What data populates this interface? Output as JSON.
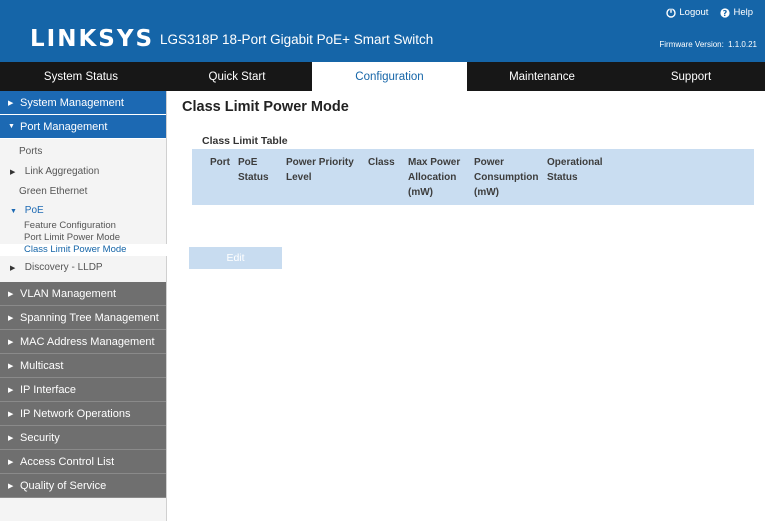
{
  "header": {
    "logo": "LINKSYS",
    "product": "LGS318P 18-Port Gigabit PoE+ Smart Switch",
    "logout": "Logout",
    "help": "Help",
    "firmware_label": "Firmware Version:",
    "firmware_version": "1.1.0.21"
  },
  "nav": {
    "tabs": [
      {
        "label": "System Status"
      },
      {
        "label": "Quick Start"
      },
      {
        "label": "Configuration",
        "active": true
      },
      {
        "label": "Maintenance"
      },
      {
        "label": "Support"
      }
    ]
  },
  "sidebar": {
    "system_management": "System Management",
    "port_management": "Port Management",
    "port_items": {
      "ports": "Ports",
      "link_aggregation": "Link Aggregation",
      "green_ethernet": "Green Ethernet",
      "poe": "PoE",
      "poe_items": [
        "Feature Configuration",
        "Port Limit Power Mode",
        "Class Limit Power Mode"
      ],
      "discovery": "Discovery - LLDP"
    },
    "groups": [
      "VLAN Management",
      "Spanning Tree Management",
      "MAC Address Management",
      "Multicast",
      "IP Interface",
      "IP Network Operations",
      "Security",
      "Access Control List",
      "Quality of Service"
    ]
  },
  "main": {
    "title": "Class Limit Power Mode",
    "table_title": "Class Limit Table",
    "columns": [
      "Port",
      "PoE Status",
      "Power Priority Level",
      "Class",
      "Max Power Allocation (mW)",
      "Power Consumption (mW)",
      "Operational Status"
    ],
    "edit_label": "Edit"
  },
  "colors": {
    "brand_blue": "#1565a8",
    "nav_bg": "#171717",
    "sidebar_active": "#1c69b3",
    "sidebar_group": "#6f6f6f",
    "table_header": "#c9ddf1"
  }
}
